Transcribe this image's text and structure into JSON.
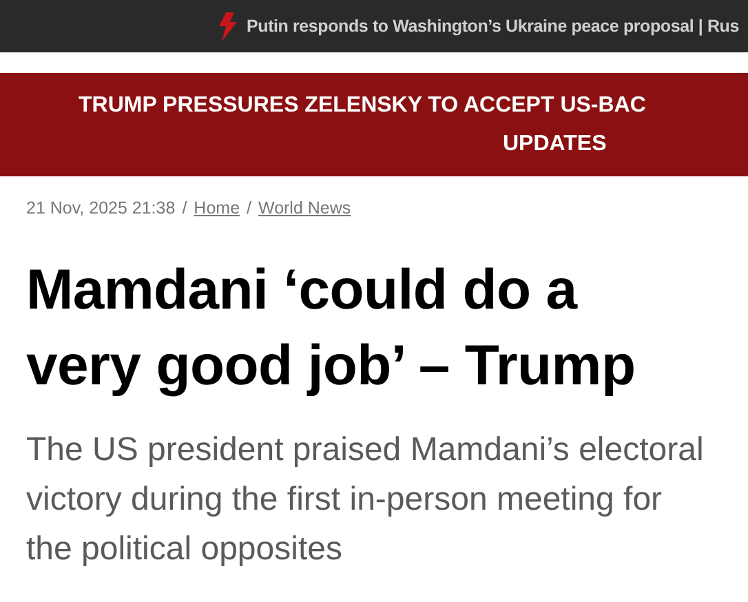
{
  "ticker": {
    "text": "Putin responds to Washington’s Ukraine peace proposal | Rus"
  },
  "banner": {
    "lines": [
      "TRUMP PRESSURES ZELENSKY TO ACCEPT US-BAC",
      "UPDATES"
    ]
  },
  "meta": {
    "date": "21 Nov, 2025 21:38",
    "breadcrumbs": [
      {
        "separator": "/",
        "label": "Home"
      },
      {
        "separator": "/",
        "label": "World News"
      }
    ]
  },
  "article": {
    "headline": "Mamdani ‘could do a very good job’ – Trump",
    "subtitle": "The US president praised Mamdani’s electoral victory during the first in-person meeting for the political opposites"
  }
}
